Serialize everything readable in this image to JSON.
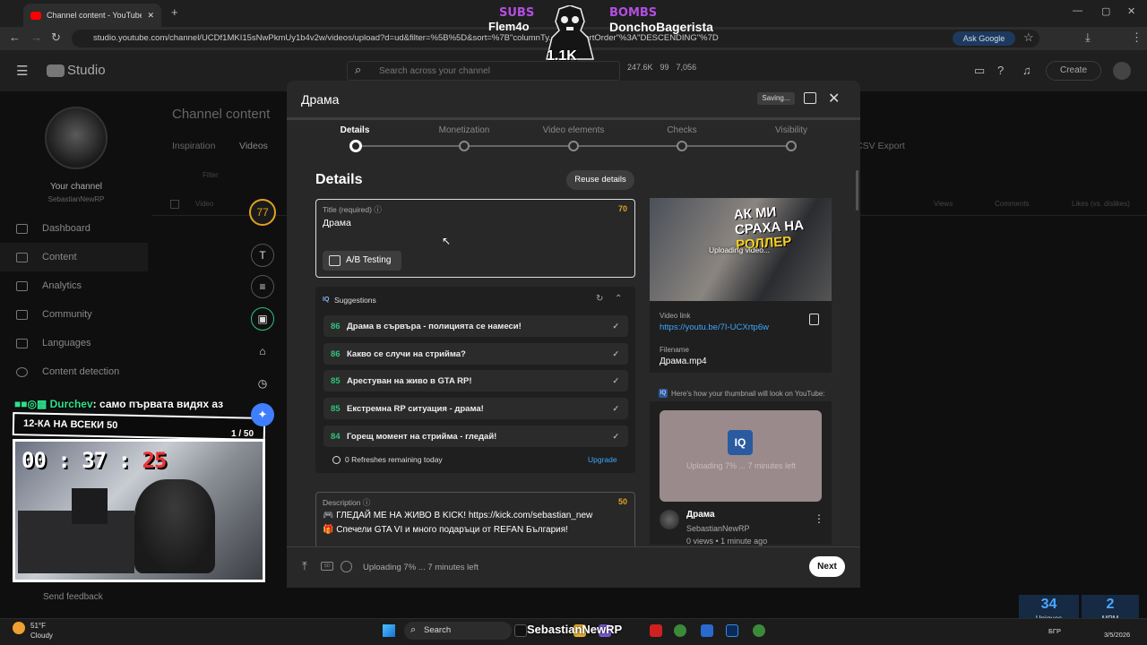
{
  "browser": {
    "tab_title": "Channel content - YouTube Stu",
    "url": "studio.youtube.com/channel/UCDf1MKI15sNwPkmUy1b4v2w/videos/upload?d=ud&filter=%5B%5D&sort=%7B\"columnTy...\"%2C\"sortOrder\"%3A\"DESCENDING\"%7D",
    "ask_google": "Ask Google"
  },
  "header": {
    "logo": "Studio",
    "search_placeholder": "Search across your channel",
    "stat_views": "247.6K",
    "stat_subs": "99",
    "stat_other": "7,056",
    "create_label": "Create"
  },
  "sidebar": {
    "channel_label": "Your channel",
    "channel_name": "SebastianNewRP",
    "items": [
      "Dashboard",
      "Content",
      "Analytics",
      "Community",
      "Languages",
      "Content detection"
    ],
    "send_feedback": "Send feedback"
  },
  "page": {
    "title": "Channel content",
    "tabs": [
      "Inspiration",
      "Videos"
    ],
    "csv_export": "CSV Export",
    "filter_placeholder": "Filter",
    "col_video": "Video",
    "col_views": "Views",
    "col_comments": "Comments",
    "col_likes": "Likes (vs. dislikes)"
  },
  "overlay": {
    "subs_label": "SUBS",
    "subs_name": "Flem4o",
    "bombs_label": "BOMBS",
    "bombs_name": "DonchoBagerista",
    "count": "1.1K",
    "chat_user": "Durchev",
    "chat_msg": ": само първата видях аз",
    "goal_text": "12-КА НА ВСЕКИ 50",
    "goal_count": "1 / 50",
    "timer_hm": "00 : 37 : ",
    "timer_s": "25"
  },
  "tools": {
    "score": "77"
  },
  "modal": {
    "title": "Драма",
    "saving": "Saving...",
    "steps": [
      "Details",
      "Monetization",
      "Video elements",
      "Checks",
      "Visibility"
    ],
    "details_heading": "Details",
    "reuse_label": "Reuse details",
    "title_label": "Title (required)",
    "title_count": "70",
    "title_value": "Драма",
    "ab_label": "A/B Testing",
    "suggestions_label": "Suggestions",
    "suggestions_iq": "IQ",
    "suggestions": [
      {
        "score": "86",
        "text": "Драма в сървъра - полицията се намеси!"
      },
      {
        "score": "86",
        "text": "Какво се случи на стрийма?"
      },
      {
        "score": "85",
        "text": "Арестуван на живо в GTA RP!"
      },
      {
        "score": "85",
        "text": "Екстремна RP ситуация - драма!"
      },
      {
        "score": "84",
        "text": "Горещ момент на стрийма - гледай!"
      }
    ],
    "refreshes": "0 Refreshes remaining today",
    "upgrade": "Upgrade",
    "desc_label": "Description",
    "desc_count": "50",
    "desc_line1": "🎮 ГЛЕДАЙ МЕ НА ЖИВО В KICK! https://kick.com/sebastian_new",
    "desc_line2": "🎁 Спечели GTA VI и много подаръци от REFAN България!",
    "thumb_text_a": "АК МИ",
    "thumb_text_b": "СРАХА НА",
    "thumb_text_c": "РОЛЛЕР",
    "uploading_processing": "Uploading video...",
    "video_link_label": "Video link",
    "video_link": "https://youtu.be/7I-UCXrtp6w",
    "filename_label": "Filename",
    "filename": "Драма.mp4",
    "preview_hint": "Here's how your thumbnail will look on YouTube:",
    "preview_iq": "IQ",
    "preview_uploading": "Uploading 7% ... 7 minutes left",
    "preview_title": "Драма",
    "preview_channel": "SebastianNewRP",
    "preview_meta": "0 views • 1 minute ago",
    "footer_status": "Uploading 7% ... 7 minutes left",
    "next_label": "Next"
  },
  "widgets": {
    "uniques_value": "34",
    "uniques_label": "Uniques",
    "mpm_value": "2",
    "mpm_label": "MPM"
  },
  "taskbar": {
    "temp": "51°F",
    "weather": "Cloudy",
    "search": "Search",
    "streamer": "SebastianNewRP",
    "lang": "БГР",
    "date": "3/5/2026"
  },
  "colors": {
    "accent_blue": "#3ea6ff",
    "score_green": "#2ec27e",
    "count_amber": "#e0a020"
  }
}
